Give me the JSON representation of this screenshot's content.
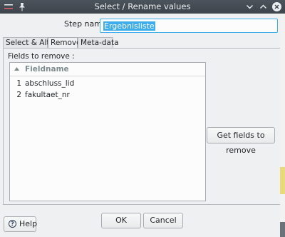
{
  "window": {
    "title": "Select / Rename values"
  },
  "icons": {
    "app": "menu-icon",
    "pin": "pin-icon",
    "minimize": "chevron-down-icon",
    "maximize": "chevron-up-icon",
    "close": "close-icon",
    "sort": "sort-up-icon",
    "help": "help-icon"
  },
  "colors": {
    "accent": "#3daee9",
    "titlebar": "#434a51"
  },
  "stepname": {
    "label": "Step name",
    "value": "Ergebnisliste"
  },
  "tabs": [
    {
      "label": "Select & Alter"
    },
    {
      "label": "Remove"
    },
    {
      "label": "Meta-data"
    }
  ],
  "remove": {
    "fields_label": "Fields to remove :",
    "table": {
      "header": "Fieldname",
      "rows": [
        {
          "num": "1",
          "fieldname": "abschluss_lid"
        },
        {
          "num": "2",
          "fieldname": "fakultaet_nr"
        }
      ]
    },
    "get_fields_label": "Get fields to remove"
  },
  "footer": {
    "ok_label": "OK",
    "cancel_label": "Cancel",
    "help_label": "Help"
  }
}
